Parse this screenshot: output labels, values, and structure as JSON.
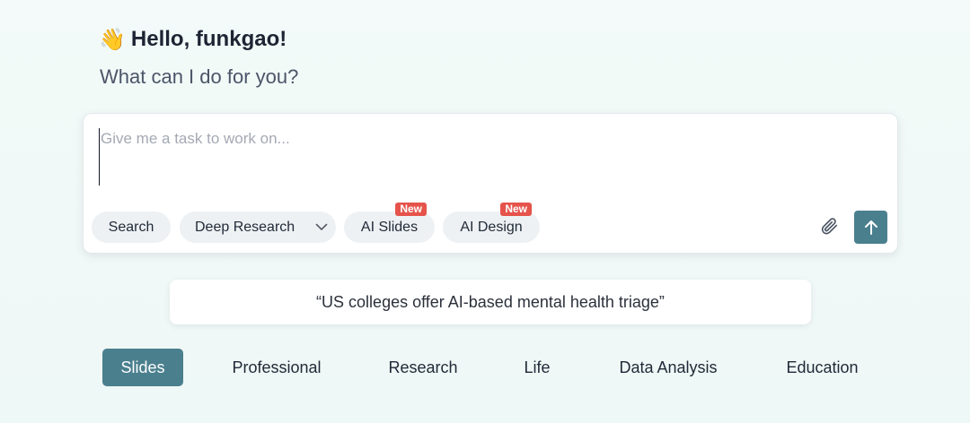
{
  "greeting": {
    "emoji": "👋",
    "text": "Hello, funkgao!",
    "subtitle": "What can I do for you?"
  },
  "composer": {
    "placeholder": "Give me a task to work on...",
    "value": "",
    "tools": [
      {
        "label": "Search",
        "badge": ""
      },
      {
        "label": "Deep Research",
        "badge": "",
        "has_dropdown": true
      },
      {
        "label": "AI Slides",
        "badge": "New"
      },
      {
        "label": "AI Design",
        "badge": "New"
      }
    ],
    "attach_icon": "paperclip-icon",
    "send_icon": "arrow-up-icon"
  },
  "suggestion": {
    "text": "“US colleges offer AI-based mental health triage”"
  },
  "tabs": [
    {
      "label": "Slides",
      "active": true
    },
    {
      "label": "Professional",
      "active": false
    },
    {
      "label": "Research",
      "active": false
    },
    {
      "label": "Life",
      "active": false
    },
    {
      "label": "Data Analysis",
      "active": false
    },
    {
      "label": "Education",
      "active": false
    }
  ],
  "colors": {
    "accent": "#4a7f8e",
    "badge": "#e5534b"
  }
}
